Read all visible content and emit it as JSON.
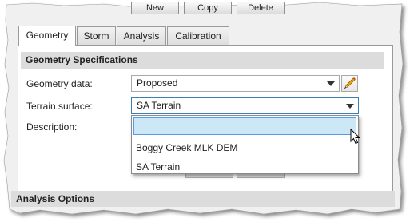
{
  "toolbar": {
    "new_label": "New",
    "copy_label": "Copy",
    "delete_label": "Delete"
  },
  "tabs": [
    {
      "label": "Geometry",
      "active": true
    },
    {
      "label": "Storm",
      "active": false
    },
    {
      "label": "Analysis",
      "active": false
    },
    {
      "label": "Calibration",
      "active": false
    }
  ],
  "geometry_specifications": {
    "header": "Geometry Specifications",
    "geometry_data_label": "Geometry data:",
    "geometry_data_value": "Proposed",
    "edit_icon": "pencil-icon",
    "terrain_surface_label": "Terrain surface:",
    "terrain_surface_value": "SA Terrain",
    "description_label": "Description:",
    "description_value": ""
  },
  "terrain_dropdown": {
    "search_value": "",
    "options": [
      "Boggy Creek MLK DEM",
      "SA Terrain"
    ]
  },
  "analysis_options": {
    "header": "Analysis Options"
  },
  "colors": {
    "section_header_bg": "#dcdcdc",
    "focus_border": "#3c7fb1",
    "dropdown_highlight": "#cce8f7",
    "pencil_body": "#e8a400"
  }
}
